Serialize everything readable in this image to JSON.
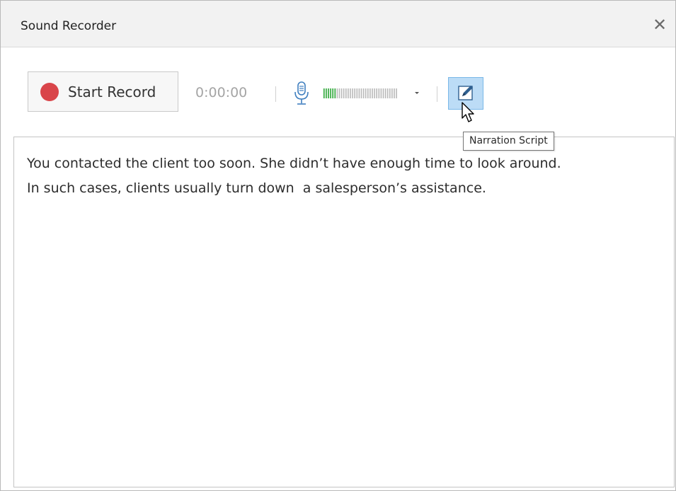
{
  "window": {
    "title": "Sound Recorder",
    "close_glyph": "✕"
  },
  "toolbar": {
    "record_label": "Start Record",
    "record_color": "#d9454a",
    "timer": "0:00:00",
    "mic_icon": "microphone-icon",
    "level_meter": {
      "level": 0.18,
      "active_color": "#2aa534",
      "inactive_color": "#b8b8b8"
    },
    "dropdown_icon": "caret-down-icon",
    "script_button_icon": "pencil-edit-icon",
    "script_button_tooltip": "Narration Script",
    "accent": "#bcdcf6"
  },
  "script": {
    "lines": [
      "You contacted the client too soon. She didn’t have enough time to look around.",
      "In such cases, clients usually turn down  a salesperson’s assistance."
    ]
  }
}
